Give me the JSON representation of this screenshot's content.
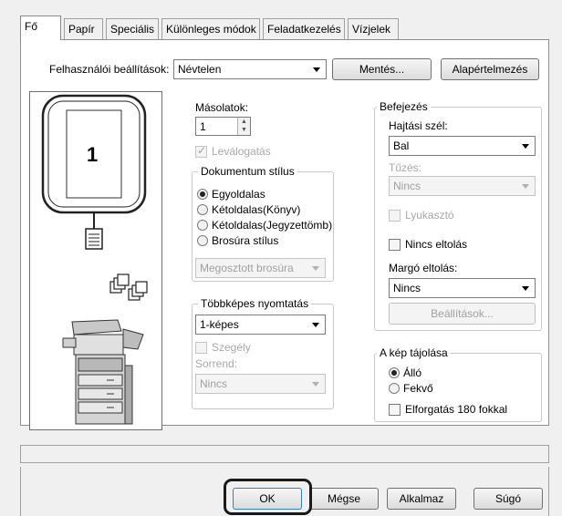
{
  "tabs": [
    {
      "label": "Fő",
      "active": true
    },
    {
      "label": "Papír"
    },
    {
      "label": "Speciális"
    },
    {
      "label": "Különleges módok"
    },
    {
      "label": "Feladatkezelés"
    },
    {
      "label": "Vízjelek"
    }
  ],
  "user_settings": {
    "label": "Felhasználói beállítások:",
    "value": "Névtelen",
    "save_button": "Mentés...",
    "defaults_button": "Alapértelmezés"
  },
  "preview": {
    "page_number": "1"
  },
  "copies": {
    "label": "Másolatok:",
    "value": "1",
    "collate_label": "Leválogatás"
  },
  "document_style": {
    "title": "Dokumentum stílus",
    "options": [
      "Egyoldalas",
      "Kétoldalas(Könyv)",
      "Kétoldalas(Jegyzettömb)",
      "Brosúra stílus"
    ],
    "selected": "Egyoldalas",
    "booklet_value": "Megosztott brosúra"
  },
  "multi_page": {
    "title": "Többképes nyomtatás",
    "value": "1-képes",
    "border_label": "Szegély",
    "order_label": "Sorrend:",
    "order_value": "Nincs"
  },
  "finishing": {
    "title": "Befejezés",
    "binding_edge_label": "Hajtási szél:",
    "binding_edge_value": "Bal",
    "staple_label": "Tűzés:",
    "staple_value": "Nincs",
    "punch_label": "Lyukasztó",
    "no_offset_label": "Nincs eltolás",
    "margin_shift_label": "Margó eltolás:",
    "margin_shift_value": "Nincs",
    "settings_button": "Beállítások..."
  },
  "orientation": {
    "title": "A kép tájolása",
    "options": [
      "Álló",
      "Fekvő"
    ],
    "selected": "Álló",
    "rotate_label": "Elforgatás 180 fokkal"
  },
  "footer": {
    "ok": "OK",
    "cancel": "Mégse",
    "apply": "Alkalmaz",
    "help": "Súgó"
  }
}
